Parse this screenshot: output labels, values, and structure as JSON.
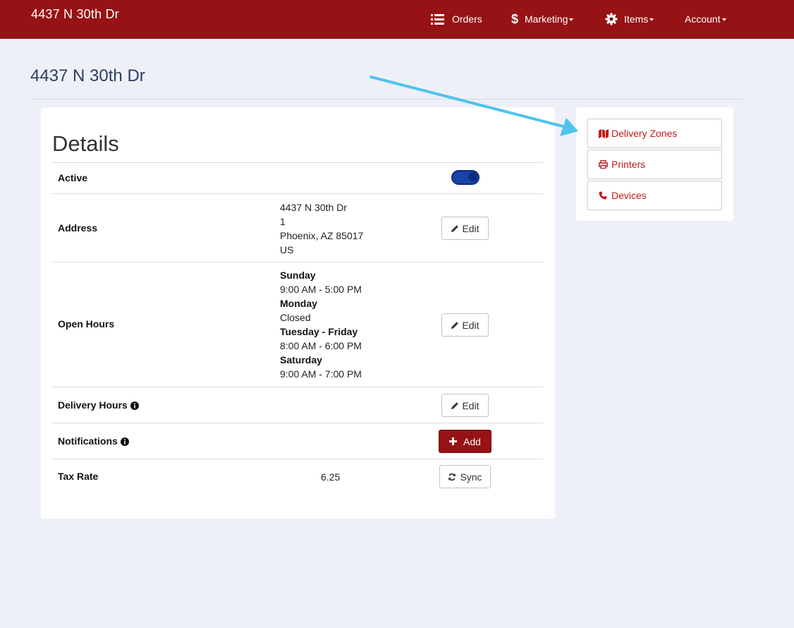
{
  "navbar": {
    "brand": "4437 N 30th Dr",
    "items": [
      {
        "label": "Orders",
        "icon": "list-icon",
        "dropdown": false
      },
      {
        "label": "Marketing",
        "icon": "dollar-icon",
        "dropdown": true
      },
      {
        "label": "Items",
        "icon": "gear-icon",
        "dropdown": true
      },
      {
        "label": "Account",
        "icon": null,
        "dropdown": true
      }
    ],
    "color": "#961214"
  },
  "page": {
    "title": "4437 N 30th Dr"
  },
  "details": {
    "title": "Details",
    "active": {
      "label": "Active",
      "enabled": true
    },
    "address": {
      "label": "Address",
      "lines": [
        "4437 N 30th Dr",
        "1",
        "Phoenix, AZ 85017",
        "US"
      ],
      "edit_label": "Edit"
    },
    "open_hours": {
      "label": "Open Hours",
      "schedule": [
        {
          "day": "Sunday",
          "hours": "9:00 AM - 5:00 PM"
        },
        {
          "day": "Monday",
          "hours": "Closed"
        },
        {
          "day": "Tuesday - Friday",
          "hours": "8:00 AM - 6:00 PM"
        },
        {
          "day": "Saturday",
          "hours": "9:00 AM - 7:00 PM"
        }
      ],
      "edit_label": "Edit"
    },
    "delivery_hours": {
      "label": "Delivery Hours",
      "edit_label": "Edit"
    },
    "notifications": {
      "label": "Notifications",
      "add_label": "Add"
    },
    "tax_rate": {
      "label": "Tax Rate",
      "value": "6.25",
      "sync_label": "Sync"
    }
  },
  "sidebar": {
    "links": [
      {
        "label": "Delivery Zones",
        "icon": "map-icon"
      },
      {
        "label": "Printers",
        "icon": "printer-icon"
      },
      {
        "label": "Devices",
        "icon": "phone-icon"
      }
    ],
    "link_color": "#c21a1a"
  },
  "colors": {
    "accent": "#961214",
    "toggle_on": "#1843a8",
    "annotation_arrow": "#4dc3ee"
  }
}
